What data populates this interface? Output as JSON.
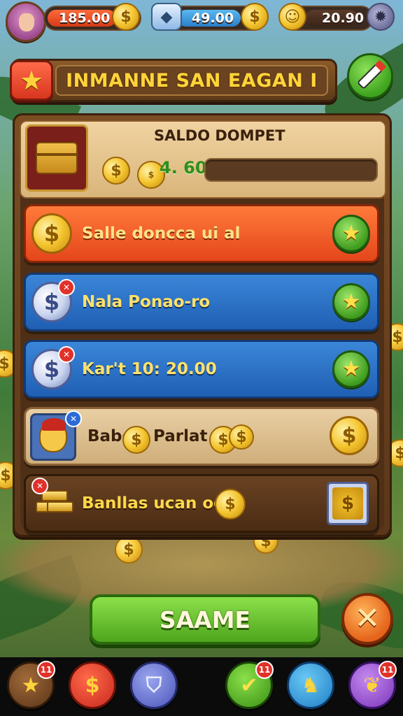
{
  "topbar": {
    "resource_1": {
      "value": "185.00",
      "icon": "coin-icon"
    },
    "resource_2": {
      "value": "49.00",
      "icon": "coin-icon"
    },
    "resource_3": {
      "value": "20.90",
      "icon": "gear-icon"
    }
  },
  "title": {
    "text": "INMANNE SAN EAGAN I"
  },
  "wallet": {
    "title": "SALDO DOMPET",
    "balance": "4. 60"
  },
  "rows": [
    {
      "label": "Salle doncca ui al",
      "style": "orange"
    },
    {
      "label": "Nala Ponao-ro",
      "style": "blue"
    },
    {
      "label": "Kar't 10: 20.00",
      "style": "blue"
    },
    {
      "label_a": "Babo",
      "label_b": "Parlat",
      "style": "tan"
    },
    {
      "label": "Banllas ucan oo",
      "style": "dark"
    }
  ],
  "actions": {
    "save_label": "SAAME",
    "close_label": "✕"
  },
  "nav": {
    "items": [
      {
        "icon": "star-icon",
        "badge": "11"
      },
      {
        "icon": "dollar-icon",
        "badge": ""
      },
      {
        "icon": "shield-icon",
        "badge": ""
      },
      {
        "icon": "check-icon",
        "badge": "11"
      },
      {
        "icon": "bird-icon",
        "badge": ""
      },
      {
        "icon": "leaf-icon",
        "badge": "11"
      }
    ]
  },
  "colors": {
    "accent_gold": "#ffd43a",
    "green_button": "#4ea51c",
    "orange_row": "#e4461b",
    "blue_row": "#1f5fb4"
  }
}
